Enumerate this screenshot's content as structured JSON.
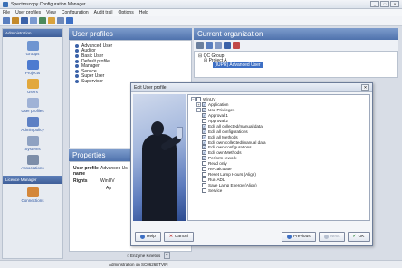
{
  "window": {
    "title": "Spectroscopy Configuration Manager",
    "controls": [
      "_",
      "□",
      "✕"
    ]
  },
  "menu": [
    "File",
    "User profiles",
    "View",
    "Configuration",
    "Audit trail",
    "Options",
    "Help"
  ],
  "sidebar": {
    "section1": "Administration",
    "items": [
      "Groups",
      "Projects",
      "Users",
      "User profiles",
      "Admin policy",
      "Systems",
      "Associations"
    ],
    "section2": "Licence Manager",
    "items2": [
      "Connections"
    ]
  },
  "profiles_panel": {
    "title": "User profiles",
    "items": [
      "Advanced User",
      "Auditor",
      "Basic User",
      "Default profile",
      "Manager",
      "Service",
      "Super User",
      "Supervisor"
    ]
  },
  "properties": {
    "title": "Properties",
    "profile_key": "User profile name",
    "profile_val": "Advanced Us",
    "rights_key": "Rights",
    "rights_val1": "WinUV",
    "rights_val2": "Ap"
  },
  "org_panel": {
    "title": "Current organization",
    "tree": [
      "QC Group",
      "Project A",
      "(IUPR) Advanced User"
    ]
  },
  "dialog": {
    "title": "Edit User profile",
    "close": "✕",
    "tree": [
      {
        "label": "WinUV",
        "level": 0,
        "exp": "−",
        "checked": false
      },
      {
        "label": "Application",
        "level": 1,
        "exp": "+",
        "checked": true
      },
      {
        "label": "Use Privileges",
        "level": 1,
        "exp": "−",
        "checked": true
      },
      {
        "label": "Approval 1",
        "level": 2,
        "exp": "",
        "checked": true
      },
      {
        "label": "Approval 2",
        "level": 2,
        "exp": "",
        "checked": false
      },
      {
        "label": "Edit all collected/manual data",
        "level": 2,
        "exp": "",
        "checked": true
      },
      {
        "label": "Edit all configurations",
        "level": 2,
        "exp": "",
        "checked": true
      },
      {
        "label": "Edit all Methods",
        "level": 2,
        "exp": "",
        "checked": true
      },
      {
        "label": "Edit own collected/manual data",
        "level": 2,
        "exp": "",
        "checked": true
      },
      {
        "label": "Edit own configurations",
        "level": 2,
        "exp": "",
        "checked": true
      },
      {
        "label": "Edit own Methods",
        "level": 2,
        "exp": "",
        "checked": true
      },
      {
        "label": "Perform rework",
        "level": 2,
        "exp": "",
        "checked": true
      },
      {
        "label": "Read only",
        "level": 2,
        "exp": "",
        "checked": false
      },
      {
        "label": "Re-calculate",
        "level": 2,
        "exp": "",
        "checked": false
      },
      {
        "label": "Reset Lamp Hours (Align)",
        "level": 2,
        "exp": "",
        "checked": false
      },
      {
        "label": "Run ADL",
        "level": 2,
        "exp": "",
        "checked": false
      },
      {
        "label": "Save Lamp Energy (Align)",
        "level": 2,
        "exp": "",
        "checked": false
      },
      {
        "label": "Service",
        "level": 2,
        "exp": "",
        "checked": false
      }
    ],
    "buttons": {
      "help": "Help",
      "cancel": "Cancel",
      "previous": "Previous",
      "next": "Next",
      "ok": "OK"
    }
  },
  "bottom": {
    "combo": "Enzyme Kinetics",
    "status": "Administration on SC0626ETVIN"
  },
  "colors": {
    "accent": "#4f72ad",
    "selection": "#3d6fc4"
  }
}
